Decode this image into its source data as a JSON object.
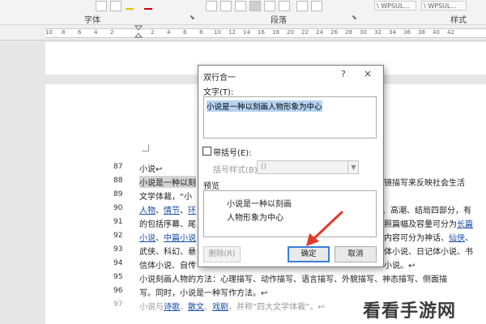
{
  "ribbon": {
    "font_group": "字体",
    "paragraph_group": "段落",
    "styles_group": "样式",
    "style_box_1": "\\ WPSUL...",
    "style_box_2": "\\ WPSUL..."
  },
  "ruler": {
    "numbers": [
      "10",
      "8",
      "6",
      "4",
      "2",
      "2",
      "4",
      "6",
      "8",
      "10",
      "12",
      "14",
      "16",
      "18",
      "20",
      "22",
      "24",
      "26",
      "28",
      "30",
      "32",
      "34",
      "36",
      "38",
      "40",
      "42"
    ]
  },
  "document": {
    "lines": [
      {
        "num": "87",
        "text": "小说↩"
      },
      {
        "num": "88",
        "left": "小说是一种以刻",
        "right": "镜描写来反映社会生活"
      },
      {
        "num": "89",
        "left": "文学体裁，“小",
        "right": ""
      },
      {
        "num": "90",
        "left_links": [
          "人物",
          "情节",
          "环"
        ],
        "right": "、高潮、结局四部分，有"
      },
      {
        "num": "91",
        "left": "的包括序幕、尾",
        "right_pre": "照篇幅及容量可分为",
        "right_link": "长篇"
      },
      {
        "num": "92",
        "left_links": [
          "小说",
          "中篇小说"
        ],
        "right_pre": "内容可分为神话、",
        "right_link": "仙侠"
      },
      {
        "num": "93",
        "left": "武侠、科幻、悬",
        "right": "体小说、日记体小说、书"
      },
      {
        "num": "94",
        "left": "信体小说、自传",
        "right": "小说。↩"
      },
      {
        "num": "95",
        "text": "小说刻画人物的方法：心理描写、动作描写、语言描写、外貌描写、神态描写、侧面描"
      },
      {
        "num": "96",
        "text": "写。同时，小说是一种写作方法。↩"
      },
      {
        "num": "97",
        "text_pre": "小说与",
        "links": [
          "诗歌",
          "散文",
          "戏剧"
        ],
        "text_post": "，并称“四大文学体裁”。↩"
      }
    ]
  },
  "dialog": {
    "title": "双行合一",
    "help": "?",
    "close": "×",
    "text_label": "文字(T):",
    "text_value": "小说是一种以刻画人物形象为中心",
    "bracket_label": "带括号(E):",
    "bracket_style_label": "括号样式(B):",
    "bracket_style_value": "()",
    "preview_label": "预览",
    "preview_line1": "小说是一种以刻画",
    "preview_line2": "人物形象为中心",
    "delete_button": "删除(R)",
    "ok_button": "确定",
    "cancel_button": "取消"
  },
  "watermark": {
    "text": "看看手游网"
  },
  "colors": {
    "accent": "#3c7fd6",
    "link": "#1a4dab",
    "arrow": "#e23a2a"
  }
}
